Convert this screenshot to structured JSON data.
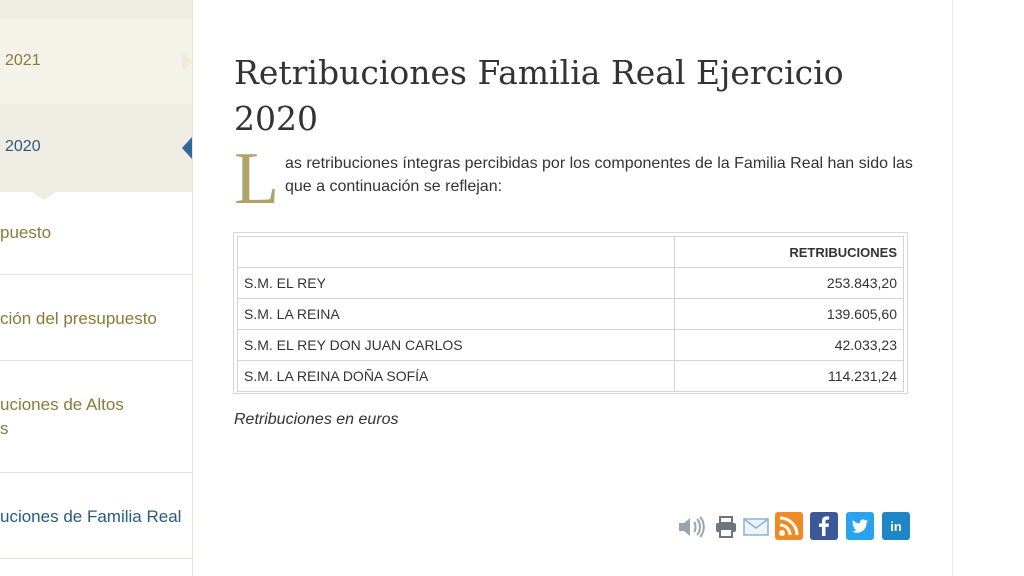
{
  "sidebar": {
    "years": [
      {
        "label": "2021"
      },
      {
        "label": "2020"
      }
    ],
    "items": [
      {
        "label": "puesto"
      },
      {
        "label": "ción del presupuesto"
      },
      {
        "label_line1": "uciones de Altos",
        "label_line2": "s"
      },
      {
        "label": "uciones de Familia Real"
      }
    ]
  },
  "main": {
    "title": "Retribuciones Familia Real Ejercicio 2020",
    "dropcap": "L",
    "intro": "as retribuciones íntegras percibidas por los componentes de la Familia Real han sido las que a continuación se reflejan:",
    "table": {
      "header": [
        "",
        "RETRIBUCIONES"
      ],
      "rows": [
        {
          "name": "S.M. EL REY",
          "value": "253.843,20"
        },
        {
          "name": "S.M. LA REINA",
          "value": "139.605,60"
        },
        {
          "name": "S.M. EL REY DON JUAN CARLOS",
          "value": "42.033,23"
        },
        {
          "name": "S.M. LA REINA DOÑA SOFÍA",
          "value": "114.231,24"
        }
      ]
    },
    "note": "Retribuciones en euros"
  },
  "share_icons": [
    "speaker-icon",
    "print-icon",
    "email-icon",
    "rss-icon",
    "facebook-icon",
    "twitter-icon",
    "linkedin-icon"
  ],
  "colors": {
    "accent_gold": "#8a7a3a",
    "active_blue": "#2a5a80",
    "rss": "#f08a24",
    "facebook": "#3b5998",
    "twitter": "#2aa3ef",
    "linkedin": "#1c86c6"
  }
}
